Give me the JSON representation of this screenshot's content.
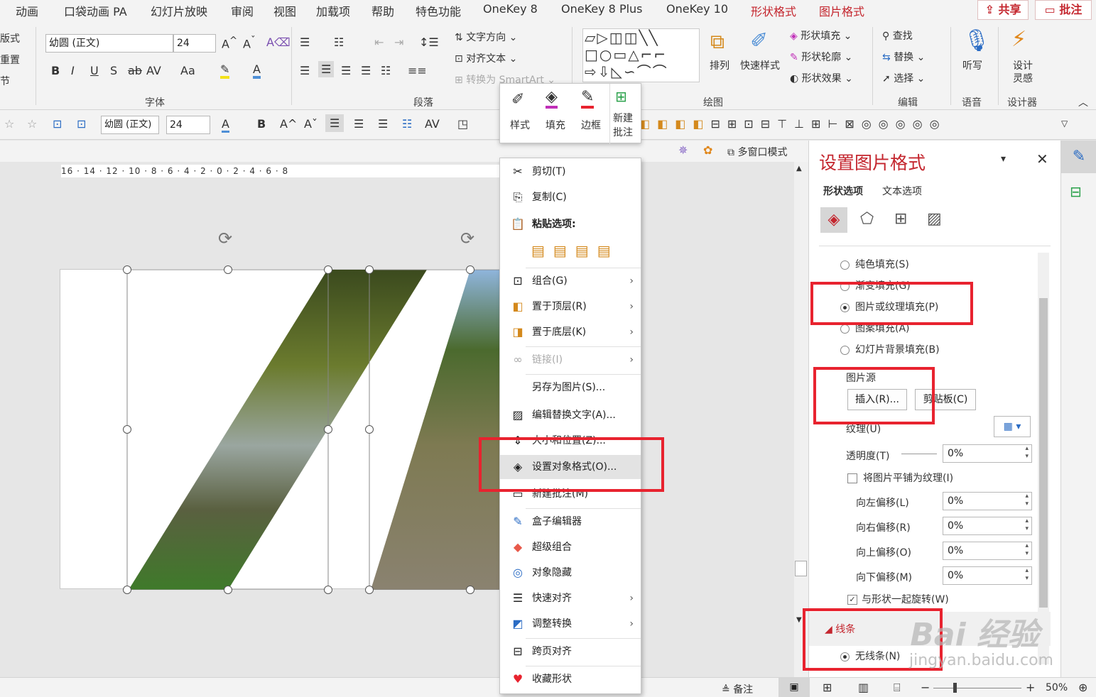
{
  "tabs": [
    {
      "label": "动画"
    },
    {
      "label": "口袋动画 PA"
    },
    {
      "label": "幻灯片放映"
    },
    {
      "label": "审阅"
    },
    {
      "label": "视图"
    },
    {
      "label": "加载项"
    },
    {
      "label": "帮助"
    },
    {
      "label": "特色功能"
    },
    {
      "label": "OneKey 8"
    },
    {
      "label": "OneKey 8 Plus"
    },
    {
      "label": "OneKey 10"
    },
    {
      "label": "形状格式"
    },
    {
      "label": "图片格式"
    }
  ],
  "share_label": "共享",
  "comment_label": "批注",
  "ribbon": {
    "font_name": "幼圆 (正文)",
    "font_size": "24",
    "font_group": "字体",
    "para_group": "段落",
    "draw_group": "绘图",
    "edit_group": "编辑",
    "voice_group": "语音",
    "designer_group": "设计器",
    "text_dir": "文字方向",
    "align_text": "对齐文本",
    "smartart": "转换为 SmartArt",
    "arrange": "排列",
    "quick_styles": "快速样式",
    "shape_fill": "形状填充",
    "shape_outline": "形状轮廓",
    "shape_effect": "形状效果",
    "find": "查找",
    "replace": "替换",
    "select": "选择",
    "dictate": "听写",
    "design_ideas_1": "设计",
    "design_ideas_2": "灵感",
    "left_1": "版式",
    "left_2": "重置",
    "left_3": "节"
  },
  "toolbar2": {
    "font_name": "幼圆 (正文)",
    "font_size": "24"
  },
  "minibar": {
    "style": "样式",
    "fill": "填充",
    "border": "边框",
    "new_comment_1": "新建",
    "new_comment_2": "批注"
  },
  "topbar": {
    "multiwindow": "多窗口模式"
  },
  "ruler": "16 · 14 · 12 · 10 · 8 · 6 · 4 · 2 · 0 · 2 · 4 · 6 · 8",
  "context_menu": [
    {
      "label": "剪切(T)",
      "icon": "scissors-icon"
    },
    {
      "label": "复制(C)",
      "icon": "copy-icon"
    },
    {
      "label": "粘贴选项:",
      "icon": "paste-icon"
    },
    {
      "label": "组合(G)",
      "icon": "group-icon"
    },
    {
      "label": "置于顶层(R)",
      "icon": "bring-front-icon"
    },
    {
      "label": "置于底层(K)",
      "icon": "send-back-icon"
    },
    {
      "label": "链接(I)",
      "icon": "link-icon"
    },
    {
      "label": "另存为图片(S)...",
      "icon": ""
    },
    {
      "label": "编辑替换文字(A)...",
      "icon": "alt-text-icon"
    },
    {
      "label": "大小和位置(Z)...",
      "icon": "size-icon"
    },
    {
      "label": "设置对象格式(O)...",
      "icon": "format-icon"
    },
    {
      "label": "新建批注(M)",
      "icon": "comment-icon"
    },
    {
      "label": "盒子编辑器",
      "icon": "box-editor-icon"
    },
    {
      "label": "超级组合",
      "icon": "super-group-icon"
    },
    {
      "label": "对象隐藏",
      "icon": "hide-icon"
    },
    {
      "label": "快速对齐",
      "icon": "align-icon"
    },
    {
      "label": "调整转换",
      "icon": "transform-icon"
    },
    {
      "label": "跨页对齐",
      "icon": "cross-align-icon"
    },
    {
      "label": "收藏形状",
      "icon": "favorite-icon"
    }
  ],
  "panel": {
    "title": "设置图片格式",
    "tab_shape": "形状选项",
    "tab_text": "文本选项",
    "fill_solid": "纯色填充(S)",
    "fill_gradient": "渐变填充(G)",
    "fill_picture": "图片或纹理填充(P)",
    "fill_pattern": "图案填充(A)",
    "fill_bg": "幻灯片背景填充(B)",
    "picture_source": "图片源",
    "insert": "插入(R)...",
    "clipboard": "剪贴板(C)",
    "texture": "纹理(U)",
    "transparency": "透明度(T)",
    "transparency_val": "0%",
    "tile": "将图片平铺为纹理(I)",
    "offset_left": "向左偏移(L)",
    "offset_left_val": "0%",
    "offset_right": "向右偏移(R)",
    "offset_right_val": "0%",
    "offset_top": "向上偏移(O)",
    "offset_top_val": "0%",
    "offset_bottom": "向下偏移(M)",
    "offset_bottom_val": "0%",
    "rotate_with": "与形状一起旋转(W)",
    "line_section": "线条",
    "no_line": "无线条(N)"
  },
  "status": {
    "notes": "备注",
    "zoom": "50%"
  },
  "watermark": {
    "brand": "Bai 经验",
    "url": "jingyan.baidu.com"
  }
}
